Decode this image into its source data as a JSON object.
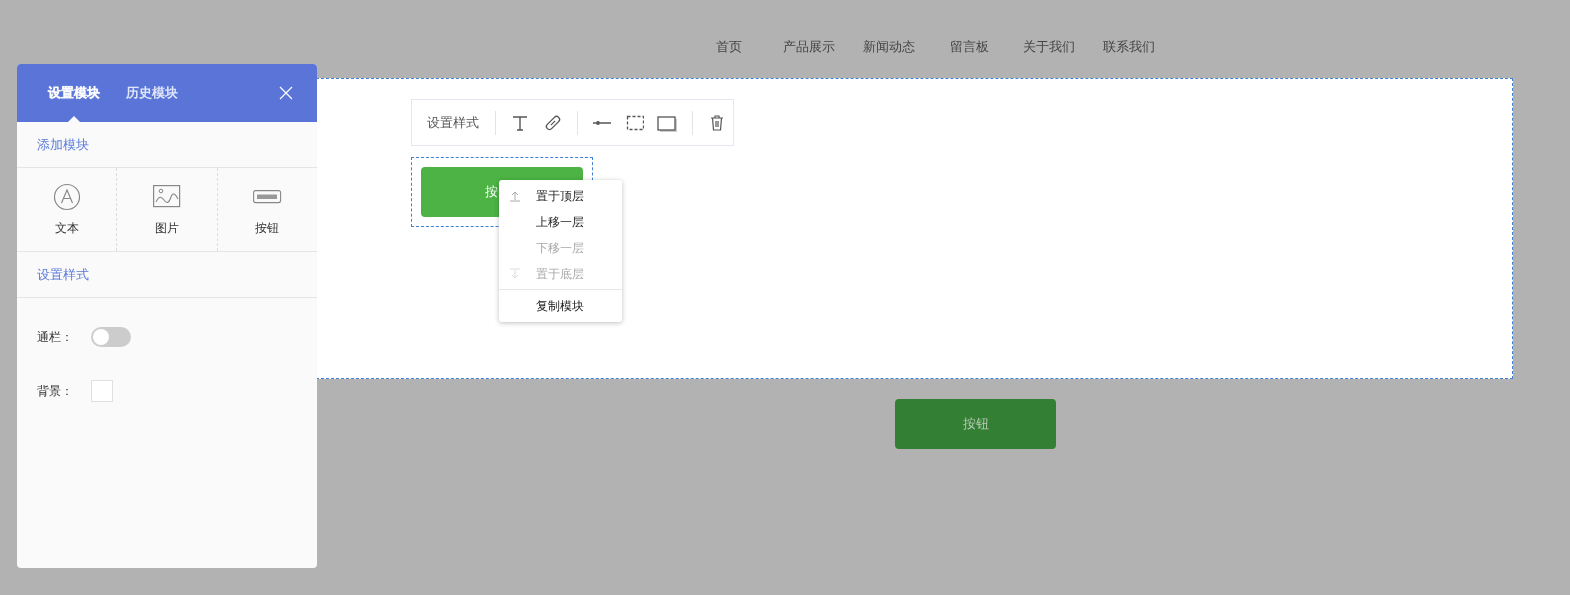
{
  "nav": [
    "首页",
    "产品展示",
    "新闻动态",
    "留言板",
    "关于我们",
    "联系我们"
  ],
  "panel": {
    "tabs": [
      {
        "label": "设置模块",
        "selected": true
      },
      {
        "label": "历史模块",
        "selected": false
      }
    ],
    "add_title": "添加模块",
    "modules": [
      {
        "kind": "text",
        "label": "文本"
      },
      {
        "kind": "image",
        "label": "图片"
      },
      {
        "kind": "button",
        "label": "按钮"
      }
    ],
    "style_title": "设置样式",
    "settings": [
      {
        "kind": "toggle",
        "label": "通栏：",
        "on": false
      },
      {
        "kind": "swatch",
        "label": "背景："
      }
    ]
  },
  "toolbar": {
    "label": "设置样式",
    "groups": [
      [
        {
          "kind": "text"
        },
        {
          "kind": "link"
        }
      ],
      [
        {
          "kind": "line"
        },
        {
          "kind": "border"
        },
        {
          "kind": "shadow"
        }
      ],
      [
        {
          "kind": "delete"
        }
      ]
    ]
  },
  "selected_button": {
    "label": "按"
  },
  "context_menu": [
    [
      {
        "kind": "top",
        "label": "置于顶层",
        "disabled": false
      },
      {
        "kind": "up",
        "label": "上移一层",
        "disabled": false
      },
      {
        "kind": "down",
        "label": "下移一层",
        "disabled": true
      },
      {
        "kind": "bottom",
        "label": "置于底层",
        "disabled": true
      }
    ],
    [
      {
        "kind": "copy",
        "label": "复制模块",
        "disabled": false
      }
    ]
  ],
  "page_button": {
    "label": "按钮"
  }
}
